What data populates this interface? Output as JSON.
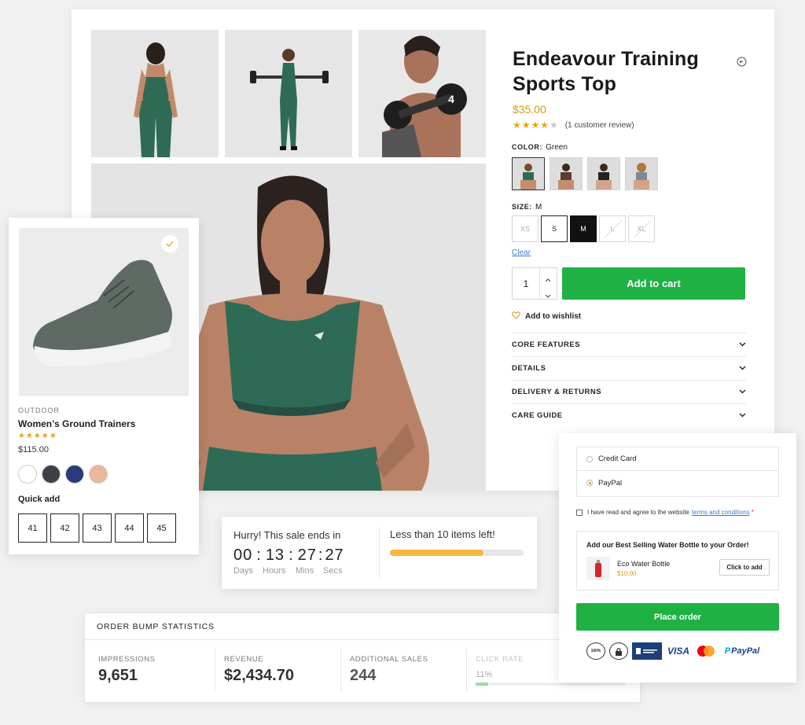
{
  "product": {
    "title_line1": "Endeavour Training",
    "title_line2": "Sports Top",
    "price": "$35.00",
    "rating": 4,
    "stars_on": "★★★★",
    "stars_off": "★",
    "review_text": "(1 customer review)",
    "color_label": "COLOR:",
    "color_value": "Green",
    "size_label": "SIZE:",
    "size_value": "M",
    "sizes": [
      "XS",
      "S",
      "M",
      "L",
      "XL"
    ],
    "clear": "Clear",
    "quantity": "1",
    "add_to_cart": "Add to cart",
    "wishlist": "Add to wishlist",
    "accordion": [
      "CORE FEATURES",
      "DETAILS",
      "DELIVERY & RETURNS",
      "CARE GUIDE"
    ]
  },
  "shoe": {
    "category": "OUTDOOR",
    "name": "Women’s Ground Trainers",
    "stars": "★★★★★",
    "price": "$115.00",
    "colors": [
      "#ffffff",
      "#3c4148",
      "#2b3a78",
      "#e9b89b"
    ],
    "quick_add": "Quick add",
    "sizes": [
      "41",
      "42",
      "43",
      "44",
      "45"
    ]
  },
  "countdown": {
    "headline": "Hurry! This sale ends in",
    "days": "00",
    "hours": "13",
    "mins": "27",
    "secs": "27",
    "days_label": "Days",
    "hours_label": "Hours",
    "mins_label": "Mins",
    "secs_label": "Secs",
    "stock_text": "Less than 10 items left!",
    "stock_fraction": 0.7
  },
  "stats": {
    "title": "ORDER BUMP STATISTICS",
    "items": [
      {
        "label": "IMPRESSIONS",
        "value": "9,651"
      },
      {
        "label": "REVENUE",
        "value": "$2,434.70"
      },
      {
        "label": "ADDITIONAL SALES",
        "value": "244"
      },
      {
        "label": "CLICK RATE",
        "value": "11%"
      }
    ]
  },
  "checkout": {
    "methods": [
      "Credit Card",
      "PayPal"
    ],
    "agree_text": "I have read and agree to the website",
    "terms": "terms and conditions",
    "required": "*",
    "bump_title": "Add our Best Selling Water Bottle to your Order!",
    "bump_item": "Eco Water Bottle",
    "bump_price": "$10.00",
    "bump_button": "Click to add",
    "place_order": "Place order",
    "badges": [
      "100%",
      "VISA",
      "PayPal"
    ]
  },
  "colors": {
    "green": "#1fb144",
    "gold": "#d69a1a",
    "star": "#e8a317",
    "progress": "#f5b83d"
  }
}
